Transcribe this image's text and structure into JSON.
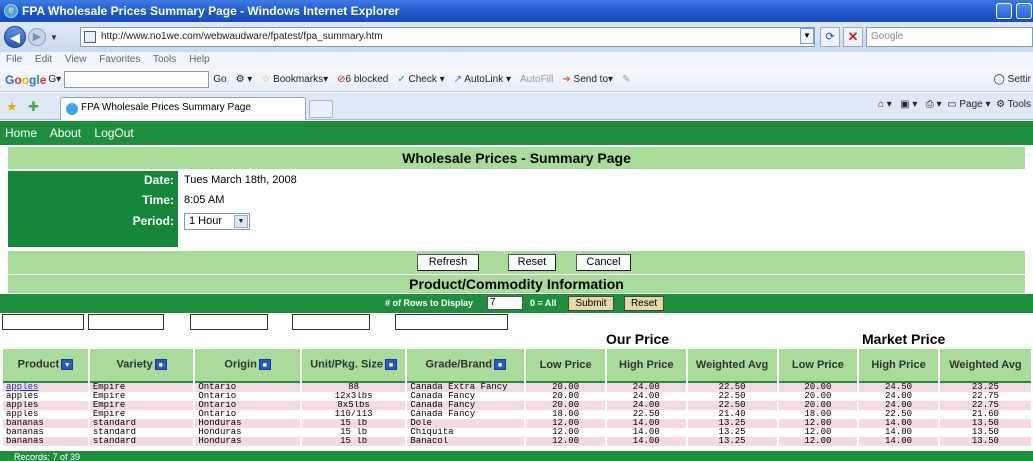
{
  "window": {
    "title": "FPA Wholesale Prices Summary Page - Windows Internet Explorer",
    "url": "http://www.no1we.com/webwaudware/fpatest/fpa_summary.htm",
    "search_placeholder": "Google"
  },
  "menu": [
    "File",
    "Edit",
    "View",
    "Favorites",
    "Tools",
    "Help"
  ],
  "google_toolbar": {
    "go": "Go",
    "bookmarks": "Bookmarks▾",
    "blocked": "6 blocked",
    "check": "Check ▾",
    "autolink": "AutoLink ▾",
    "autofill": "AutoFill",
    "send_to": "Send to▾",
    "settings": "Settir"
  },
  "tab": {
    "label": "FPA Wholesale Prices Summary Page",
    "page": "Page ▾",
    "tools": "Tools"
  },
  "nav": [
    "Home",
    "About",
    "LogOut"
  ],
  "summary": {
    "title": "Wholesale Prices - Summary Page",
    "date_label": "Date:",
    "date": "Tues March 18th, 2008",
    "time_label": "Time:",
    "time": "8:05 AM",
    "period_label": "Period:",
    "period": "1 Hour",
    "refresh": "Refresh",
    "reset": "Reset",
    "cancel": "Cancel"
  },
  "product_info": {
    "title": "Product/Commodity Information",
    "rows_label": "# of Rows to Display",
    "rows_value": "7",
    "all_hint": "0 = All",
    "submit": "Submit",
    "reset": "Reset"
  },
  "groups": {
    "our_price": "Our Price",
    "market_price": "Market Price"
  },
  "columns": {
    "product": "Product",
    "variety": "Variety",
    "origin": "Origin",
    "unit": "Unit/Pkg. Size",
    "grade": "Grade/Brand",
    "low": "Low Price",
    "high": "High Price",
    "wavg": "Weighted Avg",
    "mlow": "Low Price",
    "mhigh": "High Price",
    "mwavg": "Weighted Avg"
  },
  "rows": [
    [
      "apples",
      "Empire",
      "Ontario",
      "88",
      "Canada Extra Fancy",
      "20.00",
      "24.00",
      "22.50",
      "20.00",
      "24.50",
      "23.25"
    ],
    [
      "apples",
      "Empire",
      "Ontario",
      "12x3lbs",
      "Canada Fancy",
      "20.00",
      "24.00",
      "22.50",
      "20.00",
      "24.00",
      "22.75"
    ],
    [
      "apples",
      "Empire",
      "Ontario",
      "8x5lbs",
      "Canada Fancy",
      "20.00",
      "24.00",
      "22.50",
      "20.00",
      "24.00",
      "22.75"
    ],
    [
      "apples",
      "Empire",
      "Ontario",
      "110/113",
      "Canada Fancy",
      "18.00",
      "22.50",
      "21.40",
      "18.00",
      "22.50",
      "21.60"
    ],
    [
      "bananas",
      "standard",
      "Honduras",
      "15 lb",
      "Dole",
      "12.00",
      "14.00",
      "13.25",
      "12.00",
      "14.00",
      "13.50"
    ],
    [
      "bananas",
      "standard",
      "Honduras",
      "15 lb",
      "Chiquita",
      "12.00",
      "14.00",
      "13.25",
      "12.00",
      "14.00",
      "13.50"
    ],
    [
      "bananas",
      "standard",
      "Honduras",
      "15 lb",
      "Banacol",
      "12.00",
      "14.00",
      "13.25",
      "12.00",
      "14.00",
      "13.50"
    ]
  ],
  "status": "Records: 7 of 39",
  "colors": {
    "dark_green": "#1f8f3f",
    "light_green": "#a9dc9b",
    "row_pink": "#f5d9e6",
    "ie_blue": "#1d55c9"
  }
}
